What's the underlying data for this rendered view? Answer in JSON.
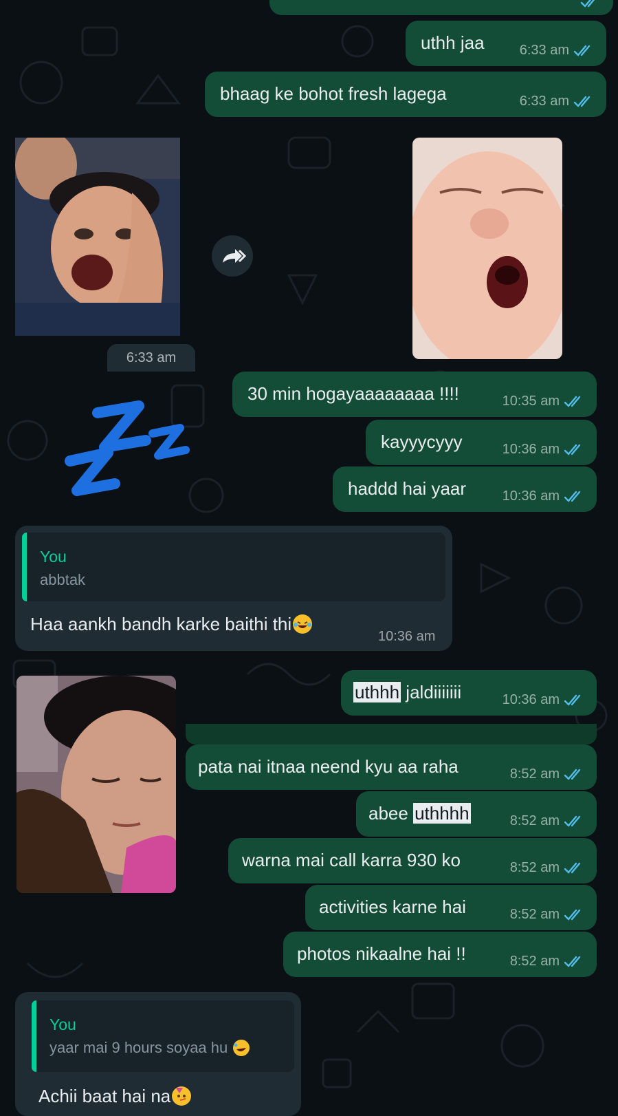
{
  "chat": {
    "messages_top": [
      {
        "text": "uthh jaa",
        "time": "6:33 am"
      },
      {
        "text": "bhaag ke bohot fresh lagega",
        "time": "6:33 am"
      }
    ],
    "media_time": "6:33 am",
    "messages_mid": [
      {
        "text": "30 min hogayaaaaaaaa !!!!",
        "time": "10:35 am"
      },
      {
        "text": "kayyycyyy",
        "time": "10:36 am"
      },
      {
        "text": "haddd hai yaar",
        "time": "10:36 am"
      }
    ],
    "reply_1": {
      "quote_author": "You",
      "quote_text": "abbtak",
      "text": "Haa aankh bandh karke baithi thi",
      "time": "10:36 am"
    },
    "message_uthhh": {
      "highlight": "uthhh",
      "rest": " jaldiiiiiii",
      "time": "10:36 am"
    },
    "messages_bottom": [
      {
        "text": "pata nai itnaa neend kyu aa raha",
        "time": "8:52 am"
      },
      {
        "prefix": "abee ",
        "highlight": "uthhhh",
        "time": "8:52 am"
      },
      {
        "text": "warna mai call karra 930 ko",
        "time": "8:52 am"
      },
      {
        "text": "activities karne hai",
        "time": "8:52 am"
      },
      {
        "text": "photos nikaalne hai !!",
        "time": "8:52 am"
      }
    ],
    "reply_2": {
      "quote_author": "You",
      "quote_text": "yaar mai 9 hours soyaa hu",
      "text": "Achii baat hai na"
    }
  },
  "colors": {
    "background": "#0b1014",
    "outgoing_bubble": "#144d37",
    "incoming_bubble": "#1f2c34",
    "read_tick": "#53bdeb",
    "quote_accent": "#06cf9c"
  },
  "icons": [
    "double-tick-read-icon",
    "forward-icon",
    "zzz-sticker",
    "laughing-emoji",
    "party-emoji",
    "rolling-laugh-emoji"
  ]
}
